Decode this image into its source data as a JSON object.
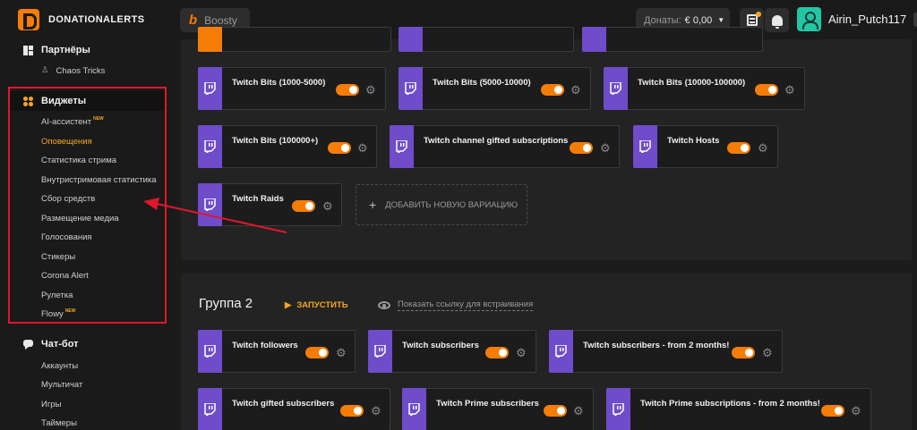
{
  "header": {
    "brand": "DONATIONALERTS",
    "boosty_label": "Boosty",
    "donations_label": "Донаты:",
    "donations_value": "€ 0,00",
    "username": "Airin_Putch117",
    "icons": [
      "feed-icon",
      "bell-icon",
      "user-avatar-icon"
    ]
  },
  "sidebar": {
    "partners_title": "Партнёры",
    "partners_item": "Chaos Tricks",
    "widgets_title": "Виджеты",
    "widgets_items": [
      {
        "label": "AI-ассистент",
        "badge": "NEW"
      },
      {
        "label": "Оповещения",
        "badge": ""
      },
      {
        "label": "Статистика стрима",
        "badge": ""
      },
      {
        "label": "Внутристримовая статистика",
        "badge": ""
      },
      {
        "label": "Сбор средств",
        "badge": ""
      },
      {
        "label": "Размещение медиа",
        "badge": ""
      },
      {
        "label": "Голосования",
        "badge": ""
      },
      {
        "label": "Стикеры",
        "badge": ""
      },
      {
        "label": "Corona Alert",
        "badge": ""
      },
      {
        "label": "Рулетка",
        "badge": ""
      },
      {
        "label": "Flowy",
        "badge": "NEW"
      }
    ],
    "chatbot_title": "Чат-бот",
    "chatbot_items": [
      "Аккаунты",
      "Мультичат",
      "Игры",
      "Таймеры"
    ]
  },
  "group1": {
    "cards": [
      "Twitch Bits (1000-5000)",
      "Twitch Bits (5000-10000)",
      "Twitch Bits (10000-100000)",
      "Twitch Bits (100000+)",
      "Twitch channel gifted subscriptions",
      "Twitch Hosts",
      "Twitch Raids"
    ],
    "add_variation": "ДОБАВИТЬ НОВУЮ ВАРИАЦИЮ"
  },
  "group2": {
    "title": "Группа 2",
    "launch_label": "ЗАПУСТИТЬ",
    "embed_label": "Показать ссылку для встраивания",
    "cards": [
      "Twitch followers",
      "Twitch subscribers",
      "Twitch subscribers - from 2 months!",
      "Twitch gifted subscribers",
      "Twitch Prime subscribers",
      "Twitch Prime subscriptions - from 2 months!"
    ]
  },
  "colors": {
    "accent": "#f57d07",
    "twitch": "#6f4cc9",
    "highlight": "#e0162b",
    "avatar": "#22c6a5"
  }
}
